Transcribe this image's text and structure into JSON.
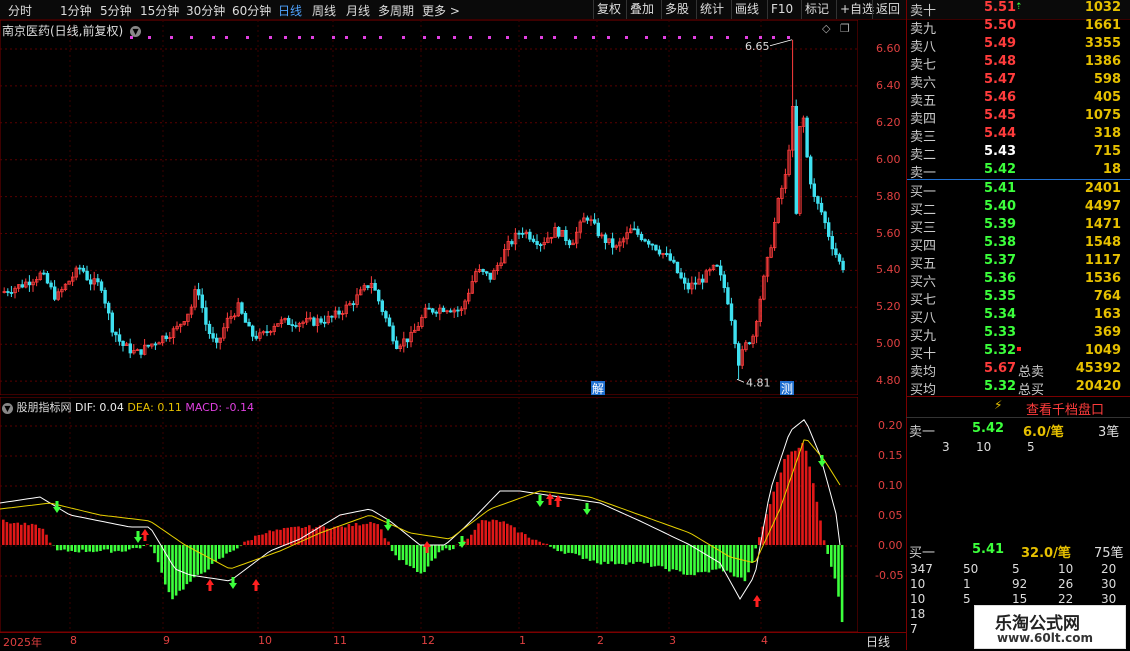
{
  "toolbar": {
    "tabs": [
      "分时",
      "1分钟",
      "5分钟",
      "15分钟",
      "30分钟",
      "60分钟",
      "日线",
      "周线",
      "月线",
      "多周期",
      "更多 >"
    ],
    "active_tab": "日线",
    "buttons": [
      "复权",
      "叠加",
      "多股",
      "统计",
      "画线",
      "F10",
      "标记",
      "+自选",
      "返回"
    ]
  },
  "chart": {
    "title": "南京医药(日线,前复权)",
    "high_label": "6.65",
    "low_label": "4.81",
    "marker_jie": "解",
    "marker_ce": "测",
    "price_ticks": [
      "6.60",
      "6.40",
      "6.20",
      "6.00",
      "5.80",
      "5.60",
      "5.40",
      "5.20",
      "5.00",
      "4.80"
    ],
    "macd_ticks": [
      "0.20",
      "0.15",
      "0.10",
      "0.05",
      "0.00",
      "-0.05"
    ],
    "x_labels": [
      "2025年",
      "8",
      "9",
      "10",
      "11",
      "12",
      "1",
      "2",
      "3",
      "4"
    ],
    "period": "日线"
  },
  "indicator": {
    "name": "股朋指标网",
    "dif": "DIF: 0.04",
    "dea": "DEA: 0.11",
    "macd": "MACD: -0.14"
  },
  "orderbook": {
    "asks": [
      {
        "label": "卖十",
        "price": "5.51",
        "vol": "1032"
      },
      {
        "label": "卖九",
        "price": "5.50",
        "vol": "1661"
      },
      {
        "label": "卖八",
        "price": "5.49",
        "vol": "3355"
      },
      {
        "label": "卖七",
        "price": "5.48",
        "vol": "1386"
      },
      {
        "label": "卖六",
        "price": "5.47",
        "vol": "598"
      },
      {
        "label": "卖五",
        "price": "5.46",
        "vol": "405"
      },
      {
        "label": "卖四",
        "price": "5.45",
        "vol": "1075"
      },
      {
        "label": "卖三",
        "price": "5.44",
        "vol": "318"
      },
      {
        "label": "卖二",
        "price": "5.43",
        "vol": "715"
      },
      {
        "label": "卖一",
        "price": "5.42",
        "vol": "18"
      }
    ],
    "bids": [
      {
        "label": "买一",
        "price": "5.41",
        "vol": "2401"
      },
      {
        "label": "买二",
        "price": "5.40",
        "vol": "4497"
      },
      {
        "label": "买三",
        "price": "5.39",
        "vol": "1471"
      },
      {
        "label": "买四",
        "price": "5.38",
        "vol": "1548"
      },
      {
        "label": "买五",
        "price": "5.37",
        "vol": "1117"
      },
      {
        "label": "买六",
        "price": "5.36",
        "vol": "1536"
      },
      {
        "label": "买七",
        "price": "5.35",
        "vol": "764"
      },
      {
        "label": "买八",
        "price": "5.34",
        "vol": "163"
      },
      {
        "label": "买九",
        "price": "5.33",
        "vol": "369"
      },
      {
        "label": "买十",
        "price": "5.32",
        "vol": "1049"
      }
    ],
    "ask_avg_label": "卖均",
    "ask_avg": "5.67",
    "total_ask_label": "总卖",
    "total_ask": "45392",
    "bid_avg_label": "买均",
    "bid_avg": "5.32",
    "total_bid_label": "总买",
    "total_bid": "20420",
    "link": "查看千档盘口",
    "ask1_label": "卖一",
    "ask1_price": "5.42",
    "ask1_per": "6.0/笔",
    "ask1_cnt": "3笔",
    "ask1_q": [
      "3",
      "10",
      "5"
    ],
    "bid1_label": "买一",
    "bid1_price": "5.41",
    "bid1_per": "32.0/笔",
    "bid1_cnt": "75笔",
    "bid1_q": [
      [
        "347",
        "50",
        "5",
        "10",
        "20"
      ],
      [
        "10",
        "1",
        "92",
        "26",
        "30"
      ],
      [
        "10",
        "5",
        "15",
        "22",
        "30"
      ],
      [
        "18"
      ],
      [
        "7"
      ]
    ]
  },
  "watermark": {
    "title": "乐淘公式网",
    "url": "www.60lt.com"
  },
  "colors": {
    "up": "#ff3c3c",
    "down": "#3fe0f0",
    "green": "#3cff3c",
    "yellow": "#e6c000",
    "magenta": "#e040e0"
  }
}
